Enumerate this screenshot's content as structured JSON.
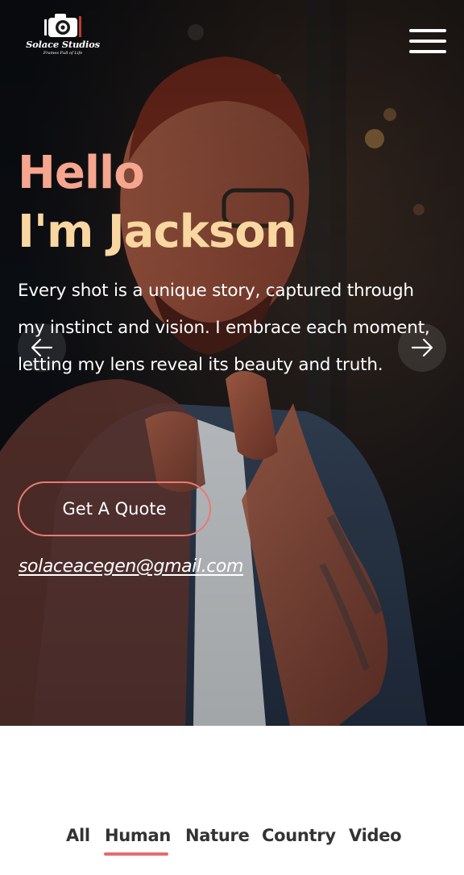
{
  "brand": {
    "name": "Solace Studios",
    "tagline": "Frames Full of Life",
    "logo_icon": "camera-icon"
  },
  "header": {
    "menu_icon": "hamburger-menu-icon"
  },
  "hero": {
    "greeting": "Hello",
    "name_line": "I'm Jackson",
    "description": "Every shot is a unique story, captured through my instinct and vision. I embrace each moment, letting my lens reveal its beauty and truth.",
    "cta_label": "Get A Quote",
    "email": "solaceacegen@gmail.com",
    "prev_icon": "arrow-left-icon",
    "next_icon": "arrow-right-icon"
  },
  "gallery_filters": {
    "tabs": [
      "All",
      "Human",
      "Nature",
      "Country",
      "Video"
    ],
    "active": "Human"
  },
  "colors": {
    "greeting": "#f6a58f",
    "name_line": "#f9d7a0",
    "accent": "#e87a74",
    "active_tab_underline": "#e26e6b",
    "tab_text": "#333333"
  }
}
